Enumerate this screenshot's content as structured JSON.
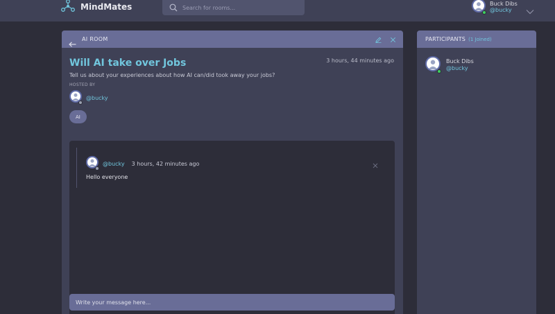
{
  "header": {
    "app_name": "MindMates",
    "search_placeholder": "Search for rooms...",
    "user_name": "Buck Dibs",
    "user_handle": "@bucky"
  },
  "room": {
    "header_label": "AI ROOM",
    "title": "Will AI take over Jobs",
    "time": "3 hours, 44 minutes ago",
    "description": "Tell us about your experiences about how AI can/did took away your jobs?",
    "hosted_by_label": "HOSTED BY",
    "host_handle": "@bucky",
    "topic_tag": "AI"
  },
  "messages": [
    {
      "handle": "@bucky",
      "time": "3 hours, 42 minutes ago",
      "body": "Hello everyone"
    }
  ],
  "composer": {
    "placeholder": "Write your message here..."
  },
  "participants": {
    "title": "PARTICIPANTS",
    "count_label": "(1 Joined)",
    "items": [
      {
        "name": "Buck Dibs",
        "handle": "@bucky"
      }
    ]
  },
  "colors": {
    "background": "#2d2d39",
    "panel": "#3f4156",
    "panel_header": "#696d97",
    "accent": "#71c6dd",
    "online": "#3ed05f"
  }
}
